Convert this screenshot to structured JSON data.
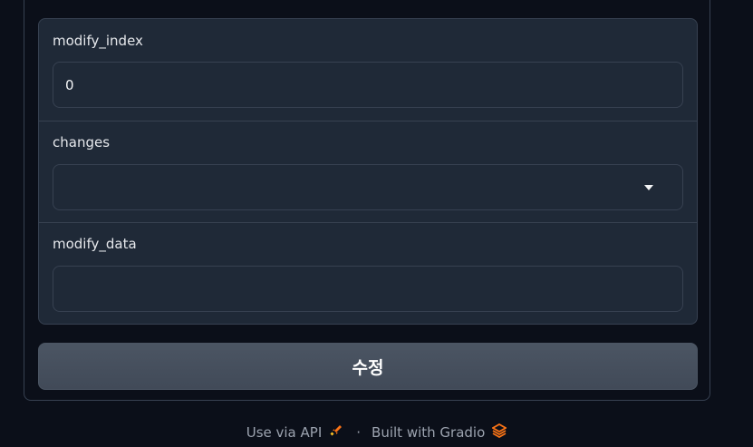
{
  "form": {
    "modify_index": {
      "label": "modify_index",
      "value": "0"
    },
    "changes": {
      "label": "changes",
      "value": ""
    },
    "modify_data": {
      "label": "modify_data",
      "value": ""
    }
  },
  "submit": {
    "label": "수정"
  },
  "footer": {
    "api_label": "Use via API",
    "separator": "·",
    "built_label": "Built with Gradio",
    "icons": [
      "rocket-icon",
      "gradio-logo-icon"
    ],
    "accent": "#f97316"
  }
}
